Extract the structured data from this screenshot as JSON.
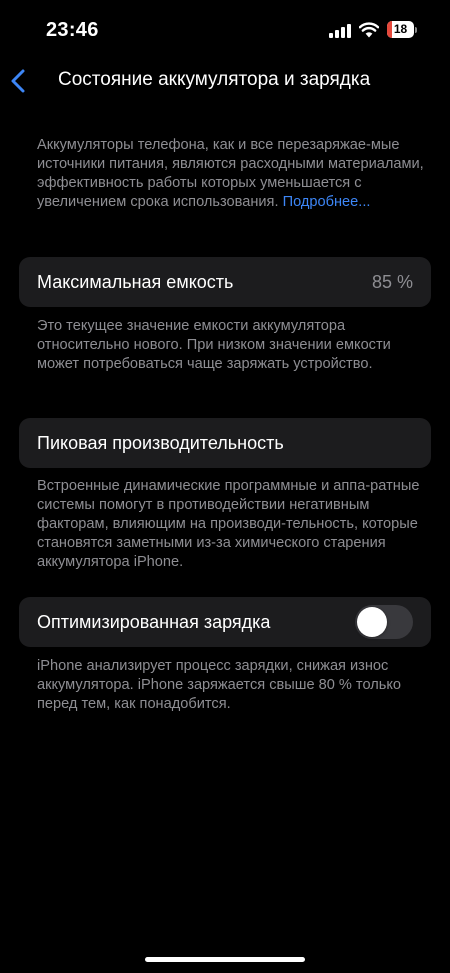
{
  "status_bar": {
    "time": "23:46",
    "battery_level": "18",
    "battery_fraction": 0.18,
    "battery_color": "#e5483b"
  },
  "nav": {
    "back_icon": "chevron-left-icon",
    "title": "Состояние аккумулятора и зарядка"
  },
  "intro": {
    "text": "Аккумуляторы телефона, как и все перезаряжае-мые источники питания, являются расходными материалами, эффективность работы которых уменьшается с увеличением срока использования.",
    "link": "Подробнее..."
  },
  "max_capacity": {
    "label": "Максимальная емкость",
    "value": "85 %",
    "footer": "Это текущее значение емкости аккумулятора относительно нового. При низком значении емкости может потребоваться чаще заряжать устройство."
  },
  "peak_performance": {
    "label": "Пиковая производительность",
    "footer": "Встроенные динамические программные и аппа-ратные системы помогут в противодействии негативным факторам, влияющим на производи-тельность, которые становятся заметными из-за химического старения аккумулятора iPhone."
  },
  "optimized_charging": {
    "label": "Оптимизированная зарядка",
    "enabled": false,
    "footer": "iPhone анализирует процесс зарядки, снижая износ аккумулятора. iPhone заряжается свыше 80 % только перед тем, как понадобится."
  },
  "colors": {
    "accent": "#3d86f6",
    "cell_background": "#1c1c1e",
    "secondary_text": "#8e8e93"
  }
}
